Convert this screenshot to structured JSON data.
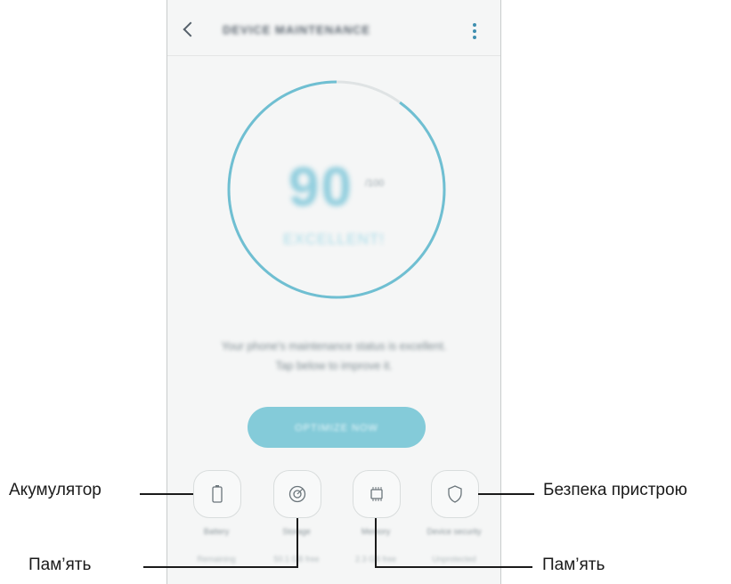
{
  "app": {
    "title": "DEVICE MAINTENANCE",
    "menu_icon": "more-vert-icon",
    "back_icon": "chevron-left-icon"
  },
  "status": {
    "score": "90",
    "score_unit": "/100",
    "grade": "EXCELLENT!",
    "description_line1": "Your phone's maintenance status is excellent.",
    "description_line2": "Tap below to improve it.",
    "progress_fraction": 0.9
  },
  "optimize_button": {
    "label": "OPTIMIZE NOW"
  },
  "categories": [
    {
      "icon": "battery-icon",
      "label": "Battery",
      "value": "Remaining"
    },
    {
      "icon": "storage-icon",
      "label": "Storage",
      "value": "50.1 GB free"
    },
    {
      "icon": "memory-chip-icon",
      "label": "Memory",
      "value": "2.3 GB free"
    },
    {
      "icon": "shield-icon",
      "label": "Device security",
      "value": "Unprotected"
    }
  ],
  "callouts": {
    "battery": "Акумулятор",
    "storage": "Пам’ять",
    "memory": "Пам’ять",
    "security": "Безпека пристрою"
  },
  "colors": {
    "accent": "#84cbd9",
    "ring": "#6fbfd2",
    "ring_track": "#dfe3e4",
    "background": "#f5f6f6"
  }
}
